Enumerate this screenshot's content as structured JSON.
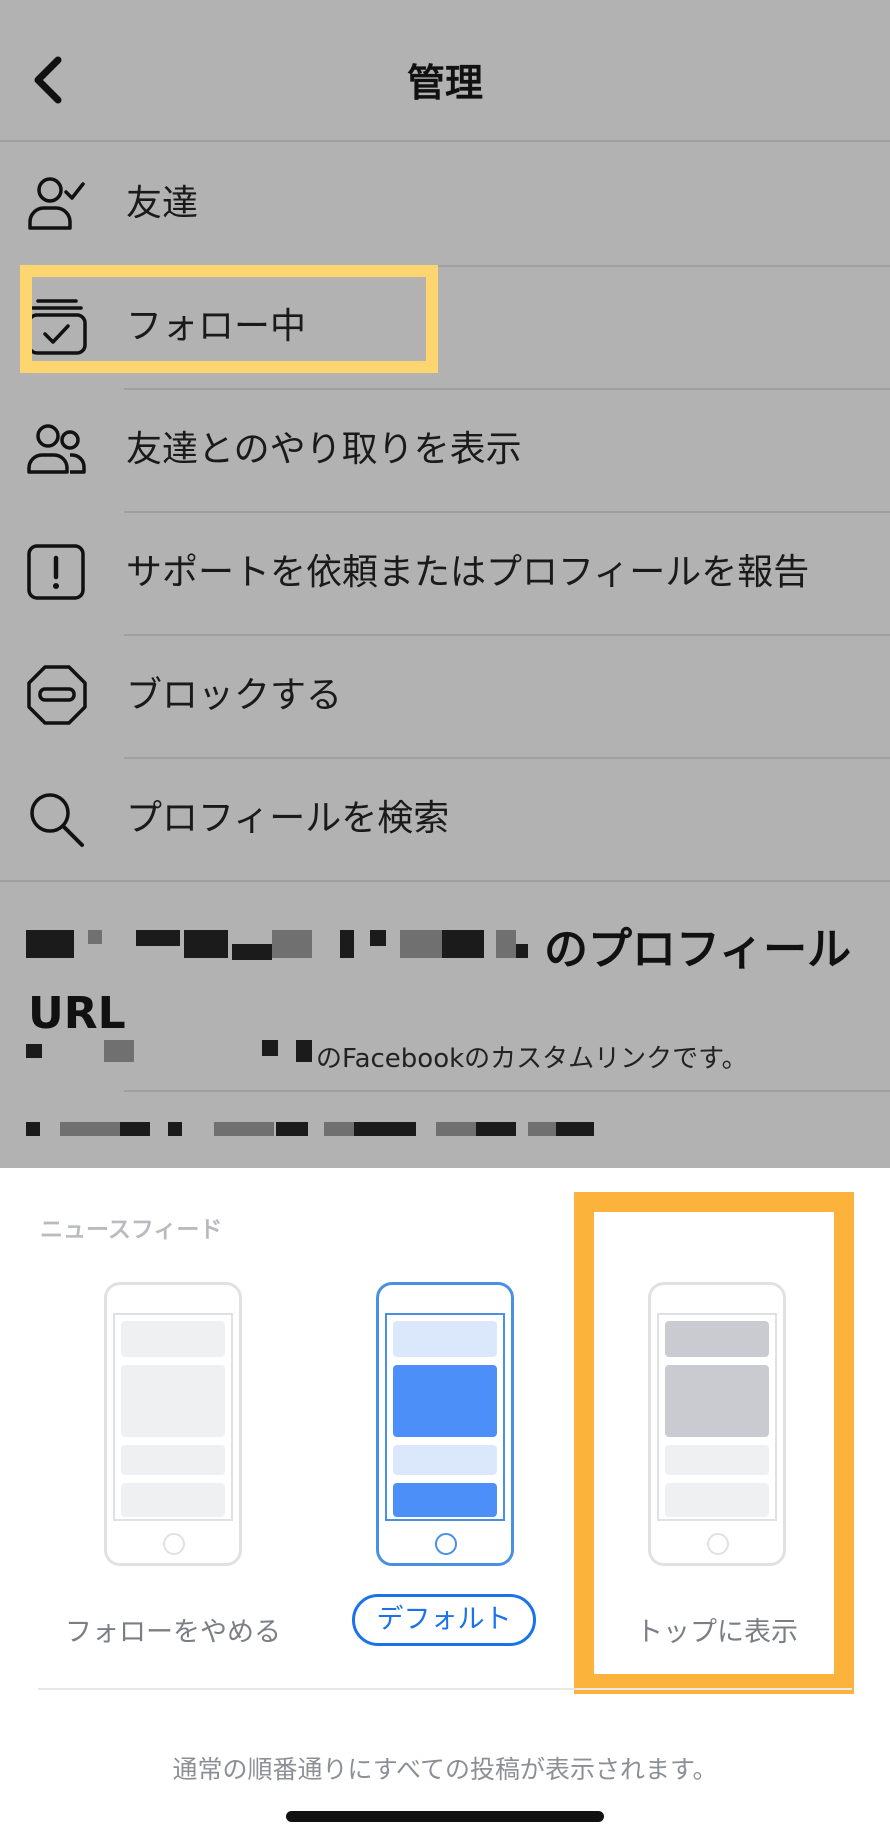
{
  "header": {
    "title": "管理",
    "back_icon": "chevron-left-icon"
  },
  "menu": {
    "items": [
      {
        "label": "友達",
        "icon": "person-check-icon"
      },
      {
        "label": "フォロー中",
        "icon": "following-stack-icon"
      },
      {
        "label": "友達とのやり取りを表示",
        "icon": "people-icon"
      },
      {
        "label": "サポートを依頼またはプロフィールを報告",
        "icon": "exclamation-box-icon"
      },
      {
        "label": "ブロックする",
        "icon": "block-octagon-icon"
      },
      {
        "label": "プロフィールを検索",
        "icon": "search-icon"
      }
    ]
  },
  "profile": {
    "title_visible": "のプロフィール",
    "title_line2": "URL",
    "subtitle_visible": "のFacebookのカスタムリンクです。"
  },
  "news_feed": {
    "section_label": "ニュースフィード",
    "options": [
      {
        "label": "フォローをやめる",
        "selected": false
      },
      {
        "label": "デフォルト",
        "selected": true
      },
      {
        "label": "トップに表示",
        "selected": false
      }
    ],
    "description": "通常の順番通りにすべての投稿が表示されます。"
  },
  "colors": {
    "overlay_gray": "#b2b2b2",
    "highlight_light_yellow": "#ffd570",
    "highlight_orange": "#fbb33b",
    "accent_blue": "#1a73e8",
    "phone_blue": "#4a90e2"
  }
}
